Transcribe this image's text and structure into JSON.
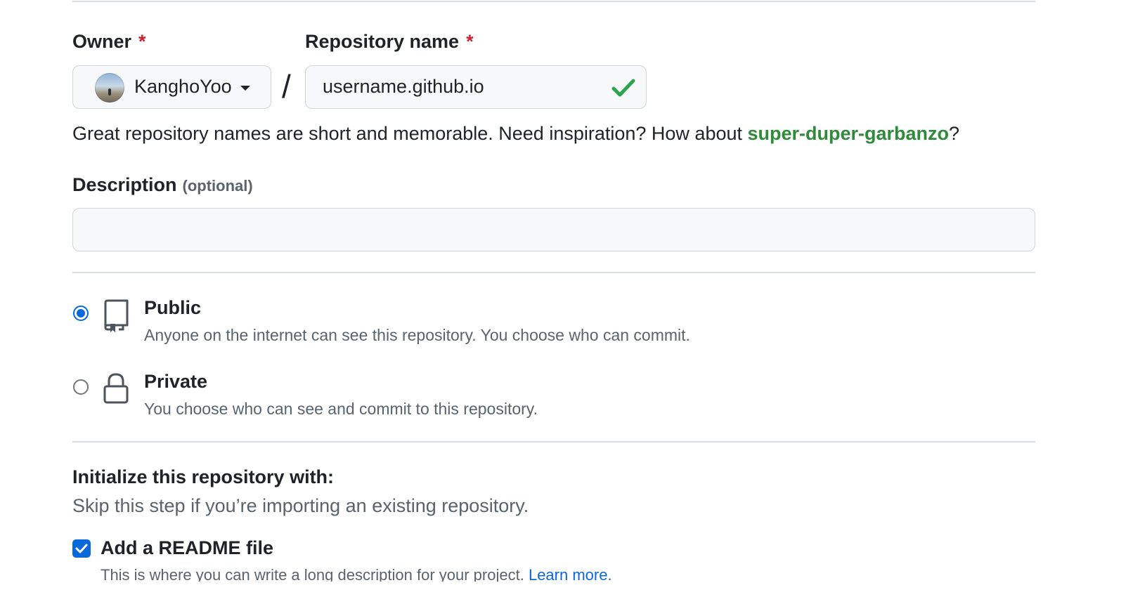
{
  "owner": {
    "label": "Owner",
    "required_mark": "*",
    "selected": "KanghoYoo"
  },
  "separator": "/",
  "repository": {
    "label": "Repository name",
    "required_mark": "*",
    "value": "username.github.io",
    "valid": true
  },
  "suggestion": {
    "text_before": "Great repository names are short and memorable. Need inspiration? How about ",
    "name": "super-duper-garbanzo",
    "text_after": "?"
  },
  "description": {
    "label": "Description",
    "optional": "(optional)",
    "value": ""
  },
  "visibility": {
    "selected": "public",
    "options": [
      {
        "id": "public",
        "icon": "repo-icon",
        "title": "Public",
        "description": "Anyone on the internet can see this repository. You choose who can commit."
      },
      {
        "id": "private",
        "icon": "lock-icon",
        "title": "Private",
        "description": "You choose who can see and commit to this repository."
      }
    ]
  },
  "initialize": {
    "title": "Initialize this repository with:",
    "subtitle": "Skip this step if you’re importing an existing repository.",
    "readme": {
      "label": "Add a README file",
      "checked": true,
      "description": "This is where you can write a long description for your project. ",
      "link": "Learn more."
    }
  },
  "colors": {
    "accent": "#0969da",
    "success": "#2e8b3a",
    "required": "#cf222e"
  }
}
